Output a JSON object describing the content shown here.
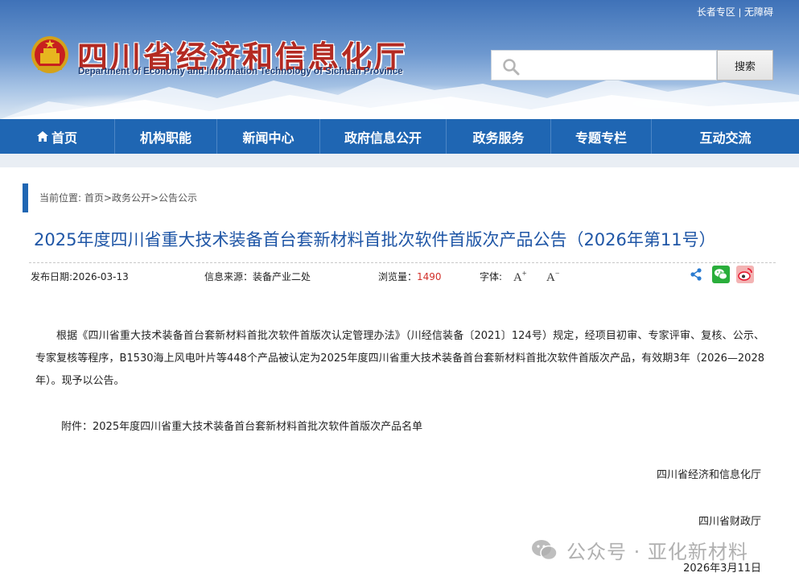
{
  "header": {
    "top_links": [
      "长者专区",
      "无障碍"
    ],
    "top_separator": "|",
    "site_title": "四川省经济和信息化厅",
    "site_subtitle": "Department of Economy and Information Technology of Sichuan Province",
    "search": {
      "placeholder": "",
      "button_label": "搜索"
    }
  },
  "nav": {
    "items": [
      {
        "label": "首页",
        "icon": "home-icon"
      },
      {
        "label": "机构职能"
      },
      {
        "label": "新闻中心"
      },
      {
        "label": "政府信息公开"
      },
      {
        "label": "政务服务"
      },
      {
        "label": "专题专栏"
      },
      {
        "label": "互动交流"
      }
    ]
  },
  "breadcrumb": {
    "prefix": "当前位置:",
    "items": [
      "首页",
      "政务公开",
      "公告公示"
    ],
    "separator": ">"
  },
  "article": {
    "title": "2025年度四川省重大技术装备首台套新材料首批次软件首版次产品公告（2026年第11号）",
    "meta": {
      "publish_date": "发布日期:2026-03-13",
      "source": "信息来源：装备产业二处",
      "views_label": "浏览量：",
      "views_count": "1490",
      "font_label": "字体:",
      "font_increase": "A",
      "font_decrease": "A"
    },
    "share_icons": [
      "share-icon",
      "wechat-icon",
      "weibo-icon"
    ],
    "body": "根据《四川省重大技术装备首台套新材料首批次软件首版次认定管理办法》（川经信装备〔2021〕124号）规定，经项目初审、专家评审、复核、公示、专家复核等程序，B1530海上风电叶片等448个产品被认定为2025年度四川省重大技术装备首台套新材料首批次软件首版次产品，有效期3年（2026—2028年）。现予以公告。",
    "attachment": "附件：2025年度四川省重大技术装备首台套新材料首批次软件首版次产品名单",
    "signatures": [
      "四川省经济和信息化厅",
      "四川省财政厅"
    ],
    "date": "2026年3月11日"
  },
  "watermark": {
    "text": "公众号 · 亚化新材料"
  },
  "colors": {
    "nav_bg": "#1f66b3",
    "title_blue": "#1f56a6",
    "site_title_red": "#b32a22",
    "views_red": "#d2302a",
    "wechat_green": "#2aae3b",
    "weibo_red": "#e6162d"
  }
}
